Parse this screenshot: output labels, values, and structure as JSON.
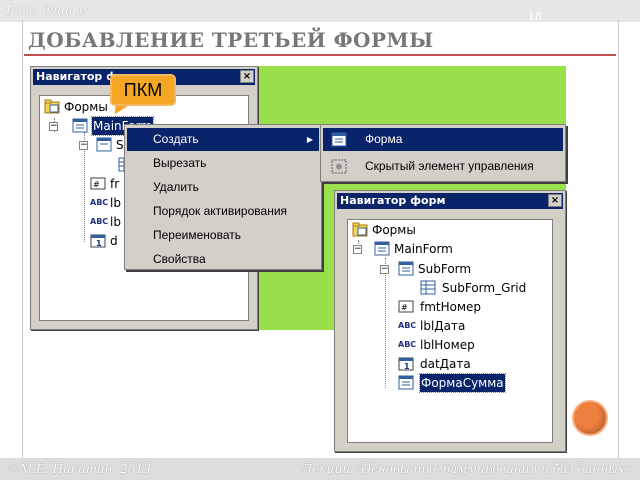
{
  "slide": {
    "section": "Базы данных",
    "number": "18",
    "title": "ДОБАВЛЕНИЕ ТРЕТЬЕЙ ФОРМЫ",
    "footer_left": "©М.Е. Никитин, 2013",
    "footer_right": "Лекции «Основы программирования и баз данных»"
  },
  "callout": {
    "text": "ПКМ"
  },
  "navigator_left": {
    "title": "Навигатор форм",
    "close": "×",
    "nodes": [
      "Формы",
      "MainForm",
      "S",
      "fr",
      "lb",
      "lb",
      "d"
    ]
  },
  "context_menu": {
    "items": [
      "Создать",
      "Вырезать",
      "Удалить",
      "Порядок активирования",
      "Переименовать",
      "Свойства"
    ],
    "submenu_arrow": "▶"
  },
  "submenu": {
    "items": [
      "Форма",
      "Скрытый элемент управления"
    ]
  },
  "navigator_right": {
    "title": "Навигатор форм",
    "close": "×",
    "nodes": {
      "root": "Формы",
      "main": "MainForm",
      "sub": "SubForm",
      "grid": "SubForm_Grid",
      "fmt": "fmtНомер",
      "lbl_date": "lblДата",
      "lbl_num": "lblНомер",
      "dat": "datДата",
      "new_form": "ФормаСумма"
    }
  },
  "icon_labels": {
    "abc": "ABC",
    "date": "1"
  },
  "colors": {
    "title_bar": "#0a246a",
    "green_area": "#99e04a",
    "callout": "#f5a623",
    "accent_rule": "#c0504d",
    "orange_dot": "#f08040"
  }
}
